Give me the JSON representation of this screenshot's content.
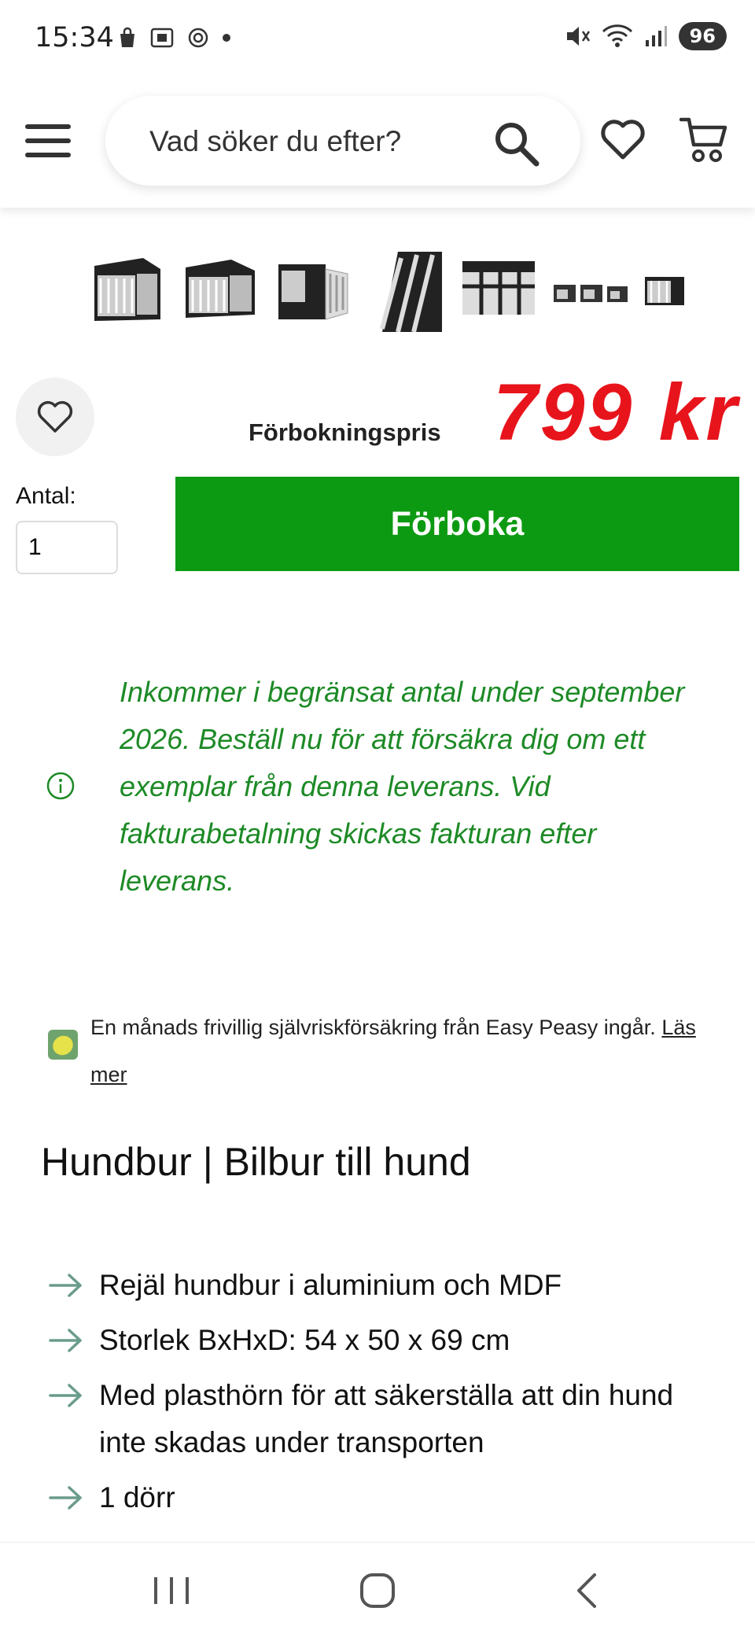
{
  "status_bar": {
    "time": "15:34",
    "battery": "96"
  },
  "header": {
    "search_placeholder": "Vad söker du efter?"
  },
  "gallery": {
    "thumbnail_count": 7,
    "active_index": 0
  },
  "product": {
    "price_label": "Förbokningspris",
    "price": "799  kr",
    "quantity_label": "Antal:",
    "quantity": "1",
    "book_button": "Förboka",
    "notice": "Inkommer i begränsat antal under september 2026. Beställ nu för att försäkra dig om ett exemplar från denna leverans. Vid fakturabetalning skickas fakturan efter leverans.",
    "insurance_text": "En månads frivillig självriskförsäkring från Easy Peasy ingår.",
    "insurance_link": "Läs mer",
    "title": "Hundbur | Bilbur till hund",
    "features": [
      "Rejäl hundbur i aluminium och MDF",
      "Storlek BxHxD: 54 x 50 x 69 cm",
      "Med plasthörn för att säkerställa att din hund inte skadas under transporten",
      "1 dörr"
    ]
  },
  "colors": {
    "price": "#e8141c",
    "book_button": "#0c9a12",
    "notice_text": "#1d8a26",
    "accent": "#6a9c8a"
  },
  "icons": [
    "hamburger-menu-icon",
    "search-icon",
    "heart-icon",
    "cart-icon",
    "info-icon",
    "lemon-icon",
    "arrow-right-icon"
  ]
}
